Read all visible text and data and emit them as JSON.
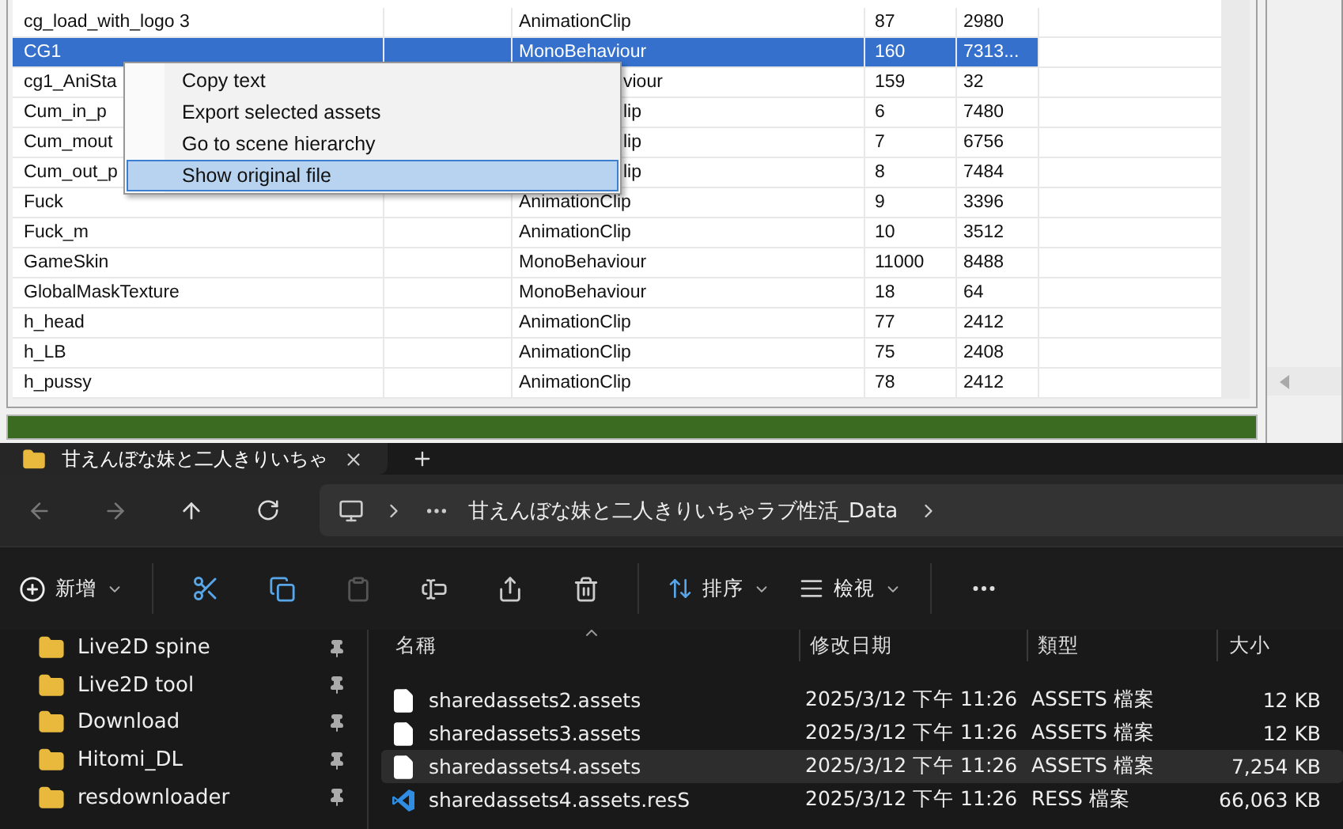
{
  "asset_table": {
    "rows": [
      {
        "name": "cg_load_with_logo 3",
        "type": "AnimationClip",
        "path_id": "87",
        "size": "2980",
        "selected": false
      },
      {
        "name": "CG1",
        "type": "MonoBehaviour",
        "path_id": "160",
        "size": "7313...",
        "selected": true
      },
      {
        "name": "cg1_AniSta",
        "type": "viour",
        "type_cut": true,
        "path_id": "159",
        "size": "32",
        "selected": false
      },
      {
        "name": "Cum_in_p",
        "type": "lip",
        "type_cut": true,
        "path_id": "6",
        "size": "7480",
        "selected": false
      },
      {
        "name": "Cum_mout",
        "type": "lip",
        "type_cut": true,
        "path_id": "7",
        "size": "6756",
        "selected": false
      },
      {
        "name": "Cum_out_p",
        "type": "lip",
        "type_cut": true,
        "path_id": "8",
        "size": "7484",
        "selected": false
      },
      {
        "name": "Fuck",
        "type": "AnimationClip",
        "path_id": "9",
        "size": "3396",
        "selected": false
      },
      {
        "name": "Fuck_m",
        "type": "AnimationClip",
        "path_id": "10",
        "size": "3512",
        "selected": false
      },
      {
        "name": "GameSkin",
        "type": "MonoBehaviour",
        "path_id": "11000",
        "size": "8488",
        "selected": false
      },
      {
        "name": "GlobalMaskTexture",
        "type": "MonoBehaviour",
        "path_id": "18",
        "size": "64",
        "selected": false
      },
      {
        "name": "h_head",
        "type": "AnimationClip",
        "path_id": "77",
        "size": "2412",
        "selected": false
      },
      {
        "name": "h_LB",
        "type": "AnimationClip",
        "path_id": "75",
        "size": "2408",
        "selected": false
      },
      {
        "name": "h_pussy",
        "type": "AnimationClip",
        "path_id": "78",
        "size": "2412",
        "selected": false
      }
    ]
  },
  "context_menu": {
    "items": [
      {
        "label": "Copy text",
        "selected": false
      },
      {
        "label": "Export selected assets",
        "selected": false
      },
      {
        "label": "Go to scene hierarchy",
        "selected": false
      },
      {
        "label": "Show original file",
        "selected": true
      }
    ]
  },
  "progress": {
    "level": 1
  },
  "explorer": {
    "tabs": [
      {
        "title": "甘えんぼな妹と二人きりいちゃ",
        "selected": true
      }
    ],
    "address": {
      "path": "甘えんぼな妹と二人きりいちゃラブ性活_Data"
    },
    "command_bar": {
      "new_label": "新增",
      "sort_label": "排序",
      "view_label": "檢視"
    },
    "sidebar": {
      "items": [
        {
          "label": "Live2D spine",
          "pinned": true
        },
        {
          "label": "Live2D tool",
          "pinned": true
        },
        {
          "label": "Download",
          "pinned": true
        },
        {
          "label": "Hitomi_DL",
          "pinned": true
        },
        {
          "label": "resdownloader",
          "pinned": true
        }
      ]
    },
    "file_list": {
      "columns": [
        "名稱",
        "修改日期",
        "類型",
        "大小"
      ],
      "rows": [
        {
          "kind": "file",
          "name": "sharedassets2.assets",
          "modified": "2025/3/12 下午 11:26",
          "type": "ASSETS 檔案",
          "size": "12 KB",
          "selected": false
        },
        {
          "kind": "file",
          "name": "sharedassets3.assets",
          "modified": "2025/3/12 下午 11:26",
          "type": "ASSETS 檔案",
          "size": "12 KB",
          "selected": false
        },
        {
          "kind": "file",
          "name": "sharedassets4.assets",
          "modified": "2025/3/12 下午 11:26",
          "type": "ASSETS 檔案",
          "size": "7,254 KB",
          "selected": true
        },
        {
          "kind": "code",
          "name": "sharedassets4.assets.resS",
          "modified": "2025/3/12 下午 11:26",
          "type": "RESS 檔案",
          "size": "66,063 KB",
          "selected": false
        }
      ]
    }
  }
}
